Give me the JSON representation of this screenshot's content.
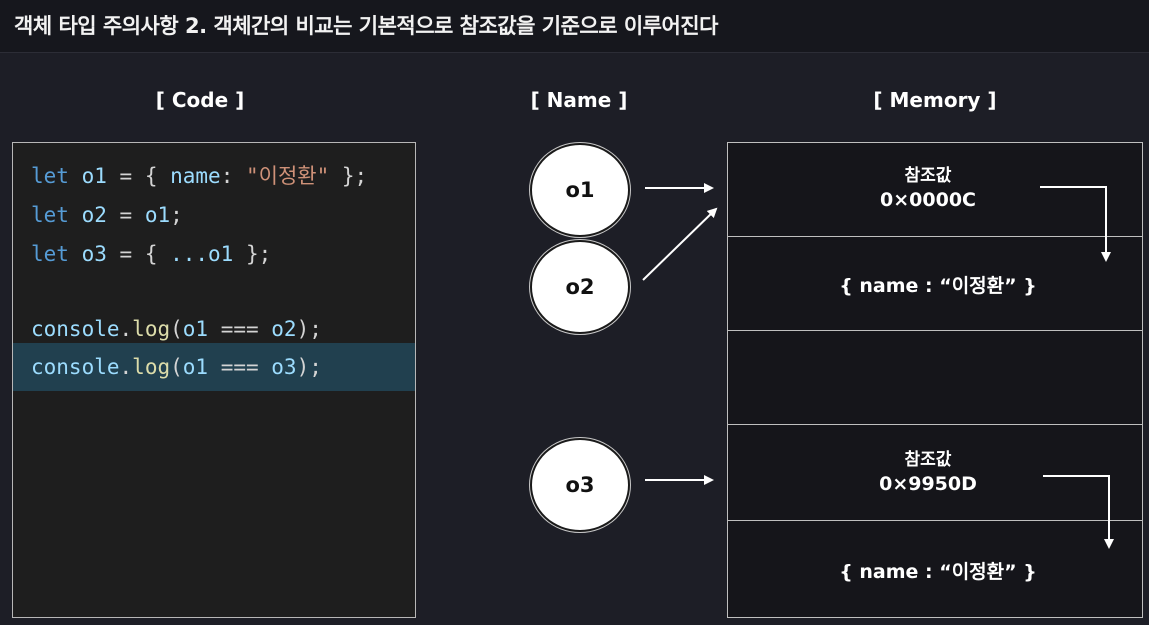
{
  "header": {
    "title": "객체 타입 주의사항 2.  객체간의 비교는 기본적으로 참조값을 기준으로 이루어진다"
  },
  "sections": {
    "code": "[ Code ]",
    "name": "[ Name ]",
    "memory": "[ Memory ]"
  },
  "code_lines": {
    "line1": {
      "kw": "let",
      "var": "o1",
      "eq": " = { ",
      "key": "name",
      "colon": ": ",
      "str": "\"이정환\"",
      "end": " };"
    },
    "line2": {
      "kw": "let",
      "var": "o2",
      "eq": " = ",
      "rhs": "o1",
      "end": ";"
    },
    "line3": {
      "kw": "let",
      "var": "o3",
      "eq": " = { ",
      "spread": "...o1",
      "end": " };"
    },
    "line5": {
      "obj": "console",
      "dot": ".",
      "fn": "log",
      "open": "(",
      "a": "o1",
      "op": " === ",
      "b": "o2",
      "close": ");"
    },
    "line6": {
      "obj": "console",
      "dot": ".",
      "fn": "log",
      "open": "(",
      "a": "o1",
      "op": " === ",
      "b": "o3",
      "close": ");"
    },
    "highlighted_line": 6
  },
  "names": {
    "o1": "o1",
    "o2": "o2",
    "o3": "o3"
  },
  "memory": {
    "cell1": {
      "label": "참조값",
      "address": "0×0000C"
    },
    "cell2": {
      "value": "{ name : “이정환” }"
    },
    "cell3": {
      "value": ""
    },
    "cell4": {
      "label": "참조값",
      "address": "0×9950D"
    },
    "cell5": {
      "value": "{ name : “이정환” }"
    }
  },
  "colors": {
    "background": "#1d1e26",
    "code_background": "#1e1e1e",
    "highlight_line": "#21404f",
    "keyword": "#569cd6",
    "variable": "#9cdcfe",
    "string": "#ce9178",
    "function": "#dcdcaa",
    "arrow": "#ffffff"
  }
}
